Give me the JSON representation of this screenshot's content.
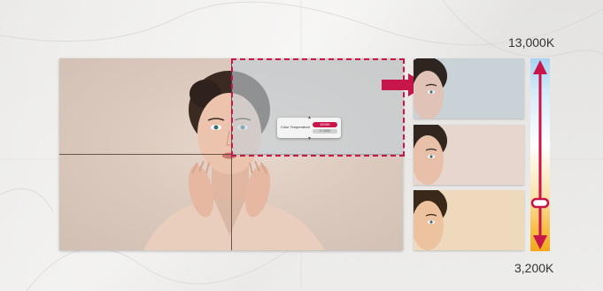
{
  "scale": {
    "top_label": "13,000K",
    "bottom_label": "3,200K"
  },
  "osd_menu": {
    "setting_label": "Color Temperature",
    "value": "3200K",
    "sub_value": "3 / 6500"
  },
  "colors": {
    "accent": "#c8154a",
    "cool_tint": "#c4d0d8",
    "warm_tint": "#efd9bd"
  }
}
